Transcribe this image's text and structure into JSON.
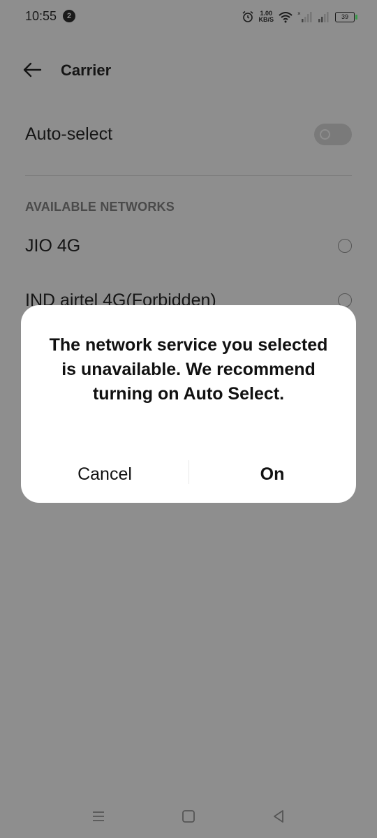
{
  "status_bar": {
    "time": "10:55",
    "notification_count": "2",
    "speed_value": "1.00",
    "speed_unit": "KB/S",
    "battery_level": "39",
    "icons": [
      "alarm-icon",
      "wifi-icon",
      "signal-icon",
      "battery-icon"
    ]
  },
  "app_bar": {
    "title": "Carrier"
  },
  "auto_select": {
    "label": "Auto-select",
    "enabled": false
  },
  "networks": {
    "header": "AVAILABLE NETWORKS",
    "items": [
      {
        "label": "JIO 4G",
        "selected": false
      },
      {
        "label": "IND airtel 4G(Forbidden)",
        "selected": false
      }
    ]
  },
  "dialog": {
    "message": "The network service you selected is unavailable. We recommend turning on Auto Select.",
    "cancel_label": "Cancel",
    "confirm_label": "On"
  },
  "nav_bar": {
    "icons": [
      "menu-icon",
      "home-icon",
      "back-triangle-icon"
    ]
  },
  "colors": {
    "scrim_background": "#8e8e8e",
    "dialog_background": "#ffffff",
    "text": "#151515"
  }
}
